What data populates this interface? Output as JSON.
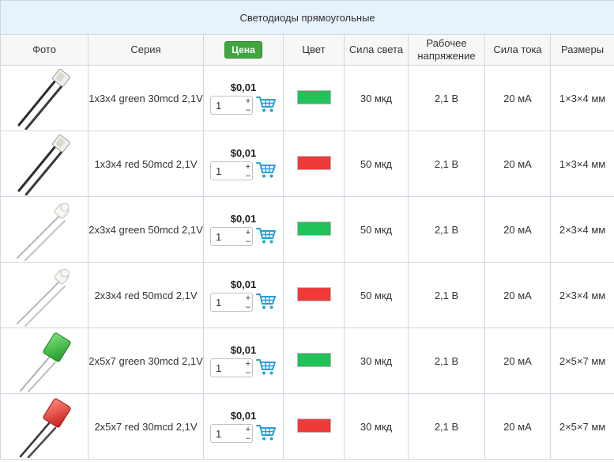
{
  "table": {
    "title": "Светодиоды прямоугольные",
    "headers": {
      "photo": "Фото",
      "series": "Серия",
      "price": "Цена",
      "color": "Цвет",
      "luminous": "Сила света",
      "voltage": "Рабочее напряжение",
      "current": "Сила тока",
      "size": "Размеры"
    },
    "rows": [
      {
        "series": "1x3x4 green 30mcd 2,1V",
        "price": "$0,01",
        "qty": "1",
        "color": "#23c15a",
        "luminous": "30 мкд",
        "voltage": "2,1 В",
        "current": "20 мА",
        "size": "1×3×4 мм"
      },
      {
        "series": "1x3x4 red 50mcd 2,1V",
        "price": "$0,01",
        "qty": "1",
        "color": "#ef3a3a",
        "luminous": "50 мкд",
        "voltage": "2,1 В",
        "current": "20 мА",
        "size": "1×3×4 мм"
      },
      {
        "series": "2x3x4 green 50mcd 2,1V",
        "price": "$0,01",
        "qty": "1",
        "color": "#23c15a",
        "luminous": "50 мкд",
        "voltage": "2,1 В",
        "current": "20 мА",
        "size": "2×3×4 мм"
      },
      {
        "series": "2x3x4 red 50mcd 2,1V",
        "price": "$0,01",
        "qty": "1",
        "color": "#ef3a3a",
        "luminous": "50 мкд",
        "voltage": "2,1 В",
        "current": "20 мА",
        "size": "2×3×4 мм"
      },
      {
        "series": "2x5x7 green 30mcd 2,1V",
        "price": "$0,01",
        "qty": "1",
        "color": "#23c15a",
        "luminous": "30 мкд",
        "voltage": "2,1 В",
        "current": "20 мА",
        "size": "2×5×7 мм"
      },
      {
        "series": "2x5x7 red 30mcd 2,1V",
        "price": "$0,01",
        "qty": "1",
        "color": "#ef3a3a",
        "luminous": "30 мкд",
        "voltage": "2,1 В",
        "current": "20 мА",
        "size": "2×5×7 мм"
      }
    ]
  },
  "icons": {
    "cart": "shopping-cart-icon",
    "photo": "led-photo"
  },
  "colors": {
    "title_bg": "#e6f3fb",
    "price_badge": "#41a63f",
    "cart_icon": "#2a9fd6",
    "border": "#cfd8e2"
  }
}
